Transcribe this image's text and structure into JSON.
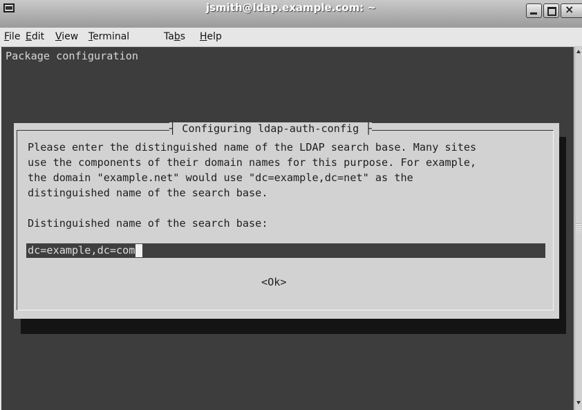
{
  "window": {
    "title": "jsmith@ldap.example.com: ~"
  },
  "menu": [
    {
      "label": "File",
      "mnemonic": "F",
      "rest": "ile"
    },
    {
      "label": "Edit",
      "mnemonic": "E",
      "rest": "dit"
    },
    {
      "label": "View",
      "mnemonic": "V",
      "rest": "iew"
    },
    {
      "label": "Terminal",
      "mnemonic": "T",
      "rest": "erminal"
    },
    {
      "label": "Tabs",
      "pre": "Ta",
      "mnemonic": "b",
      "rest": "s"
    },
    {
      "label": "Help",
      "mnemonic": "H",
      "rest": "elp"
    }
  ],
  "terminal": {
    "screen_title": "Package configuration"
  },
  "dialog": {
    "title": "Configuring ldap-auth-config",
    "description_lines": [
      "Please enter the distinguished name of the LDAP search base. Many sites",
      "use the components of their domain names for this purpose. For example,",
      "the domain \"example.net\" would use \"dc=example,dc=net\" as the",
      "distinguished name of the search base."
    ],
    "prompt": "Distinguished name of the search base:",
    "input_value": "dc=example,dc=com",
    "ok_label": "<Ok>"
  },
  "colors": {
    "terminal_bg": "#3d3d3d",
    "dialog_bg": "#d2d2d2",
    "input_bg": "#3f3f3f"
  }
}
